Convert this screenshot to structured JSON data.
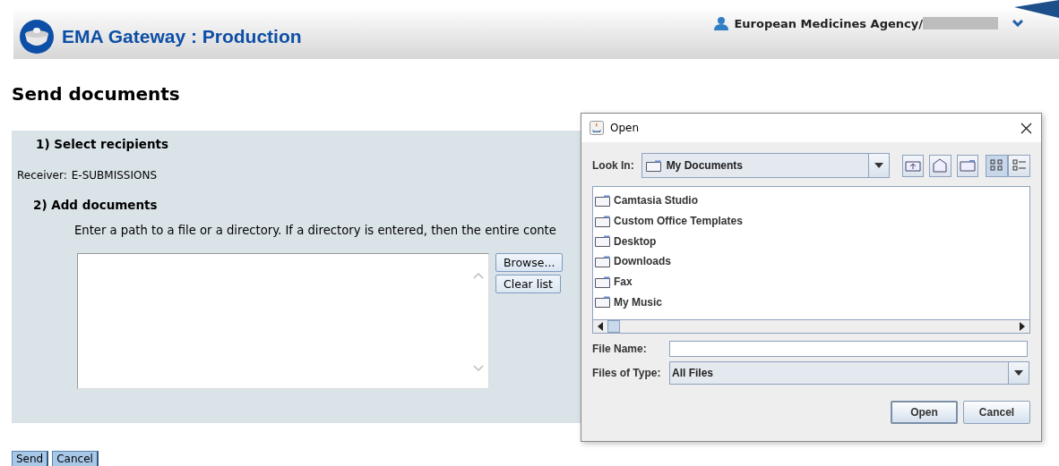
{
  "header": {
    "title": "EMA Gateway : Production",
    "account": "European Medicines Agency/"
  },
  "page": {
    "title": "Send documents",
    "step1": "1) Select recipients",
    "receiver_label": "Receiver:",
    "receiver": "E-SUBMISSIONS",
    "step2": "2) Add documents",
    "instructions": "Enter a path to a file or a directory. If a directory is entered, then the entire conte",
    "side_buttons": [
      "Browse...",
      "Clear list"
    ],
    "buttons": [
      "Send",
      "Cancel"
    ]
  },
  "dialog": {
    "title": "Open",
    "look_in_label": "Look In:",
    "look_in": "My Documents",
    "view_buttons": [
      {
        "kind": "list",
        "selected": true
      },
      {
        "kind": "details",
        "selected": false
      }
    ],
    "files": [
      "Camtasia Studio",
      "Custom Office Templates",
      "Desktop",
      "Downloads",
      "Fax",
      "My Music"
    ],
    "file_name_label": "File Name:",
    "files_of_type_label": "Files of Type:",
    "files_of_type": "All Files",
    "buttons": [
      "Open",
      "Cancel"
    ]
  }
}
